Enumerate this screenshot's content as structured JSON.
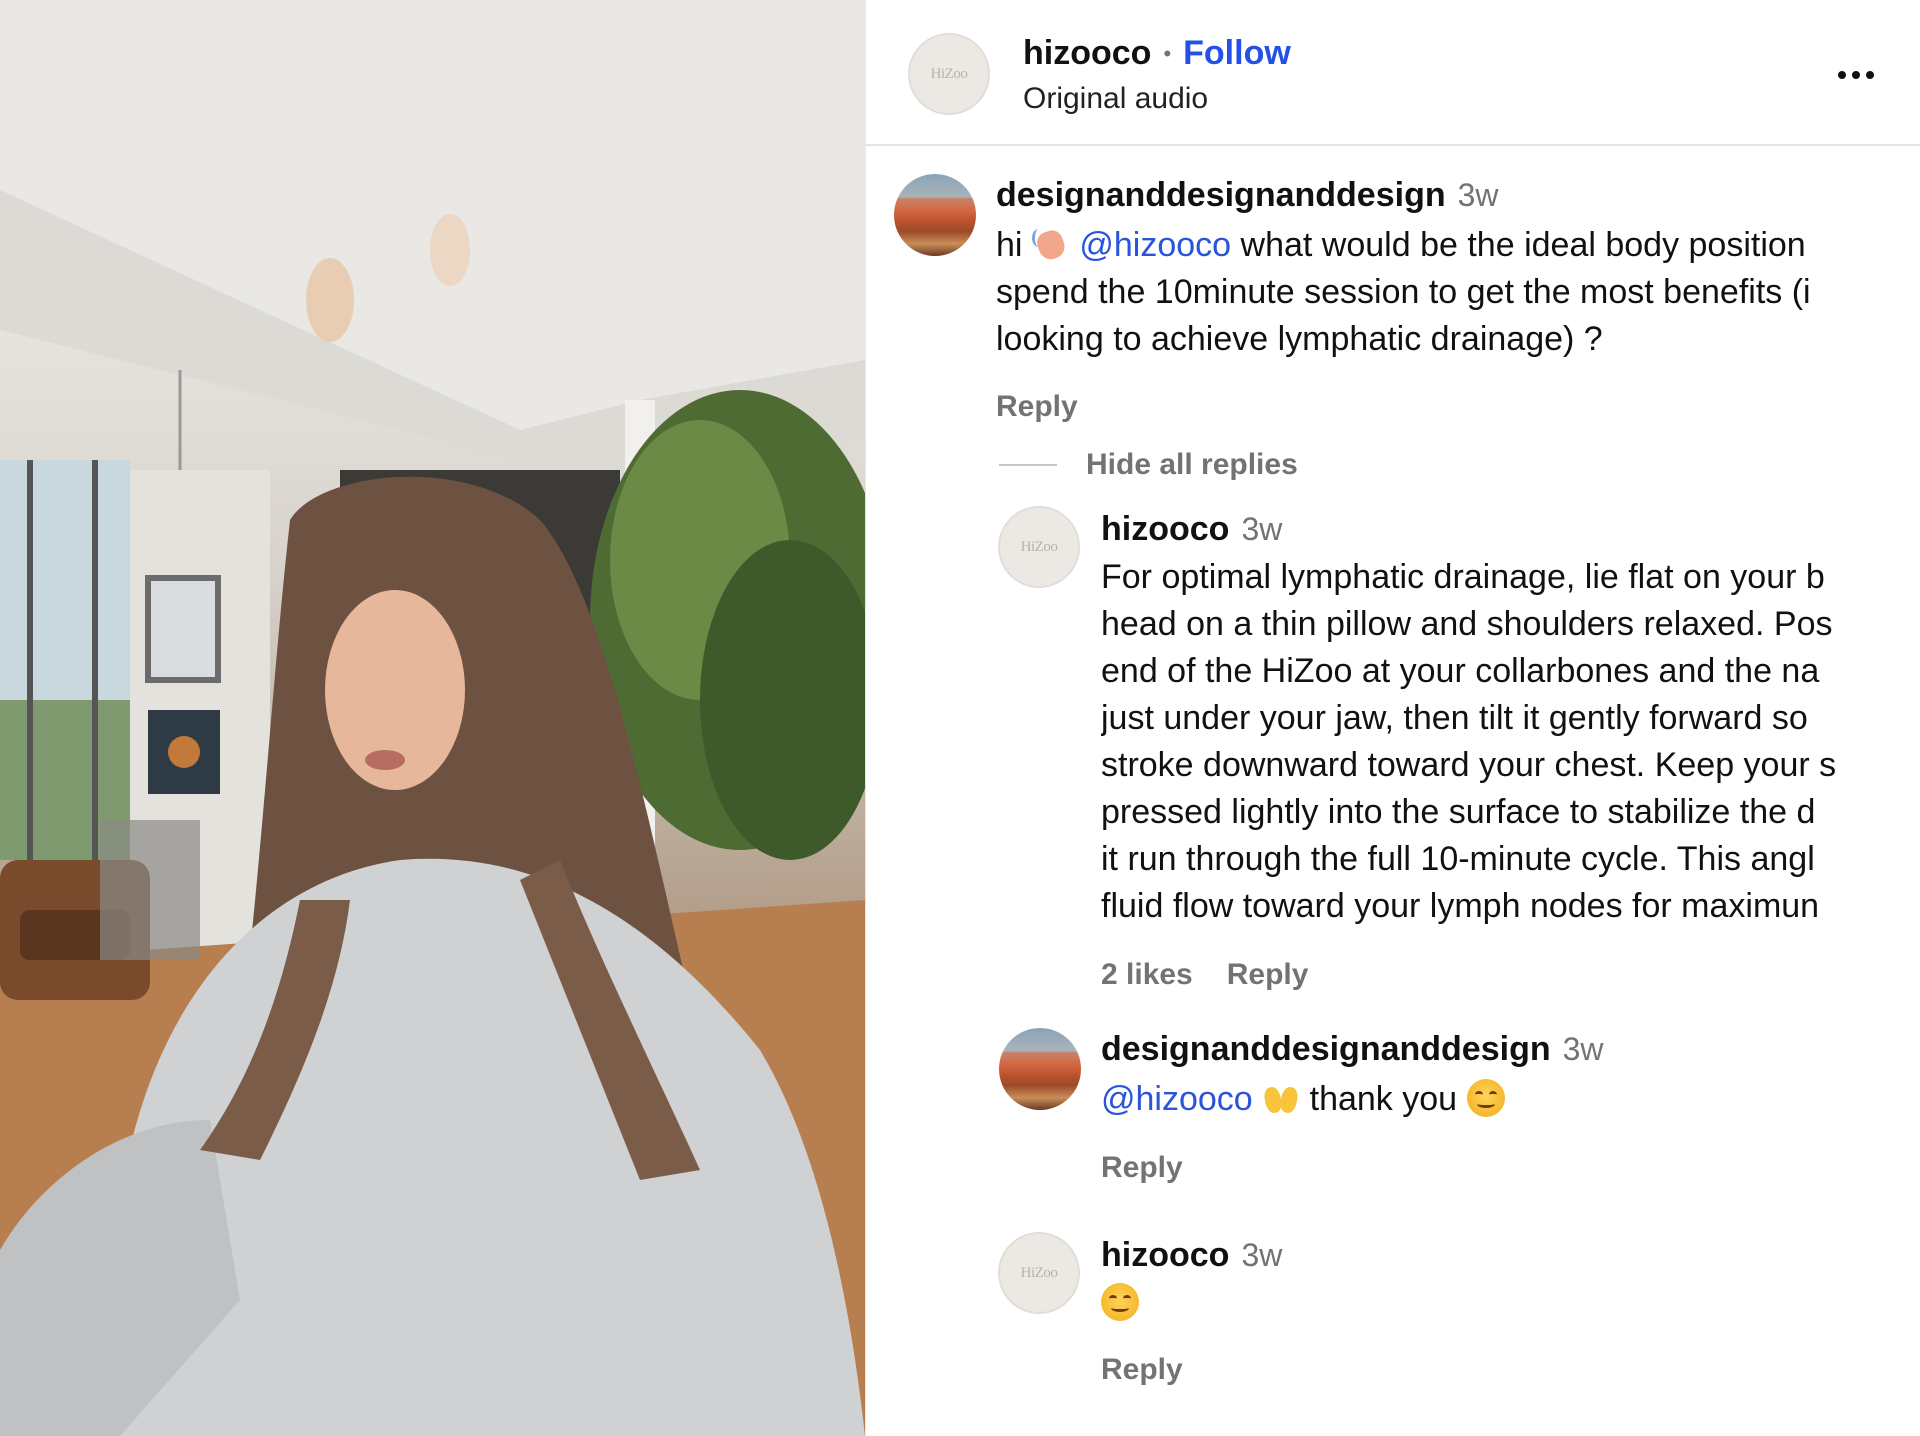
{
  "header": {
    "avatar_text": "HiZoo",
    "username": "hizooco",
    "separator": "•",
    "follow_label": "Follow",
    "audio_label": "Original audio"
  },
  "comments": [
    {
      "username": "designanddesignanddesign",
      "time": "3w",
      "text_prefix": "hi",
      "mention": "@hizooco",
      "lines": [
        "what would be the ideal body position",
        "spend the 10minute session to get the most benefits (i",
        "looking to achieve lymphatic drainage) ?"
      ],
      "reply_label": "Reply"
    }
  ],
  "replies_toggle": "Hide all replies",
  "replies": [
    {
      "avatar_text": "HiZoo",
      "username": "hizooco",
      "time": "3w",
      "lines": [
        "For optimal lymphatic drainage, lie flat on your b",
        "head on a thin pillow and shoulders relaxed. Pos",
        "end of the HiZoo at your collarbones and the na",
        "just under your jaw, then tilt it gently forward so",
        "stroke downward toward your chest. Keep your s",
        "pressed lightly into the surface to stabilize the d",
        "it run through the full 10-minute cycle. This angl",
        "fluid flow toward your lymph nodes for maximun"
      ],
      "likes_label": "2 likes",
      "reply_label": "Reply"
    },
    {
      "username": "designanddesignanddesign",
      "time": "3w",
      "mention": "@hizooco",
      "text": "thank you",
      "reply_label": "Reply"
    },
    {
      "avatar_text": "HiZoo",
      "username": "hizooco",
      "time": "3w",
      "reply_label": "Reply"
    }
  ],
  "icons": {
    "more": "more-options-icon",
    "wave": "waving-hand-emoji",
    "hands": "raising-hands-emoji",
    "smile": "smiling-face-emoji"
  },
  "colors": {
    "link_blue": "#2450e8",
    "muted": "#737373"
  }
}
